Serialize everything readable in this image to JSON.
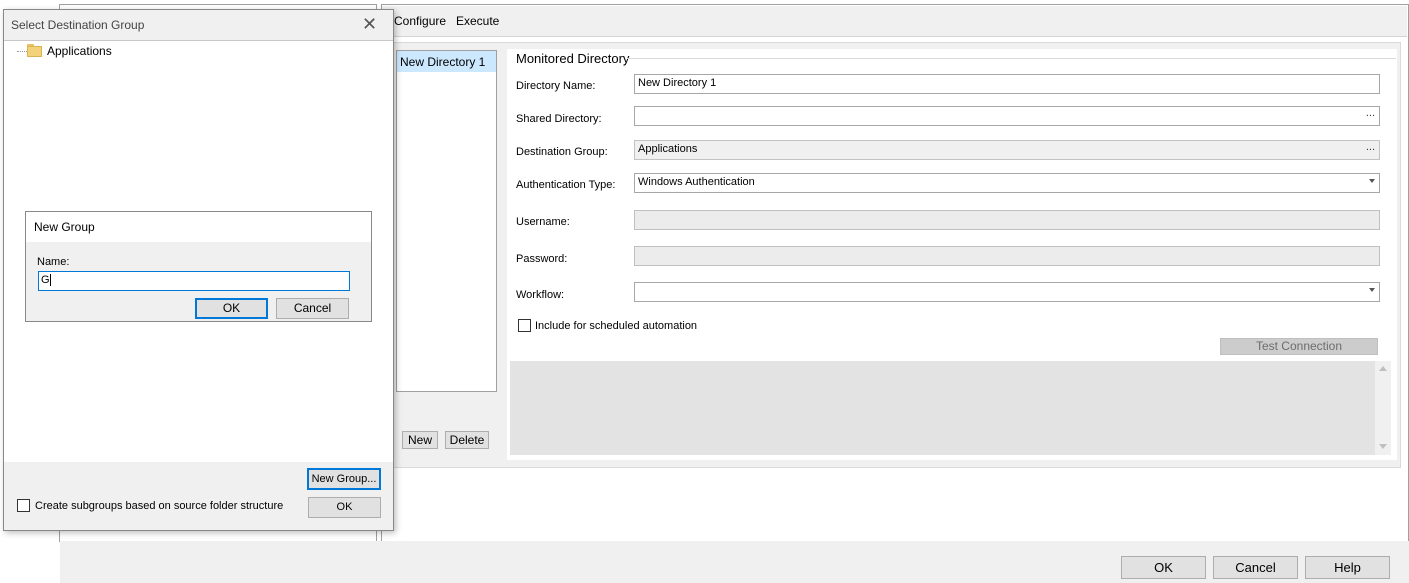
{
  "tabs": [
    {
      "label": "Configure"
    },
    {
      "label": "Execute"
    }
  ],
  "directory_list": {
    "items": [
      {
        "label": "New Directory 1",
        "selected": true
      }
    ],
    "new_label": "New",
    "delete_label": "Delete"
  },
  "monitored_directory": {
    "title": "Monitored Directory",
    "directory_name_label": "Directory Name:",
    "directory_name_value": "New Directory 1",
    "shared_directory_label": "Shared Directory:",
    "shared_directory_value": "",
    "destination_group_label": "Destination Group:",
    "destination_group_value": "Applications",
    "authentication_type_label": "Authentication Type:",
    "authentication_type_value": "Windows Authentication",
    "username_label": "Username:",
    "username_value": "",
    "password_label": "Password:",
    "password_value": "",
    "workflow_label": "Workflow:",
    "workflow_value": "",
    "ellipsis": "...",
    "include_scheduled_label": "Include for scheduled automation",
    "include_scheduled_checked": false,
    "test_connection_label": "Test Connection"
  },
  "bottom_buttons": {
    "ok": "OK",
    "cancel": "Cancel",
    "help": "Help"
  },
  "select_dialog": {
    "title": "Select Destination Group",
    "close_symbol": "✕",
    "tree": [
      {
        "label": "Applications",
        "icon": "folder-icon"
      }
    ],
    "new_group_label": "New Group...",
    "ok_label": "OK",
    "subgroups_label": "Create subgroups based on source folder structure",
    "subgroups_checked": false
  },
  "new_group_dialog": {
    "title": "New Group",
    "name_label": "Name:",
    "name_value": "G",
    "ok_label": "OK",
    "cancel_label": "Cancel"
  },
  "colors": {
    "selection": "#cce8ff",
    "focus_border": "#0078d7",
    "panel_bg": "#f0f0f0"
  }
}
